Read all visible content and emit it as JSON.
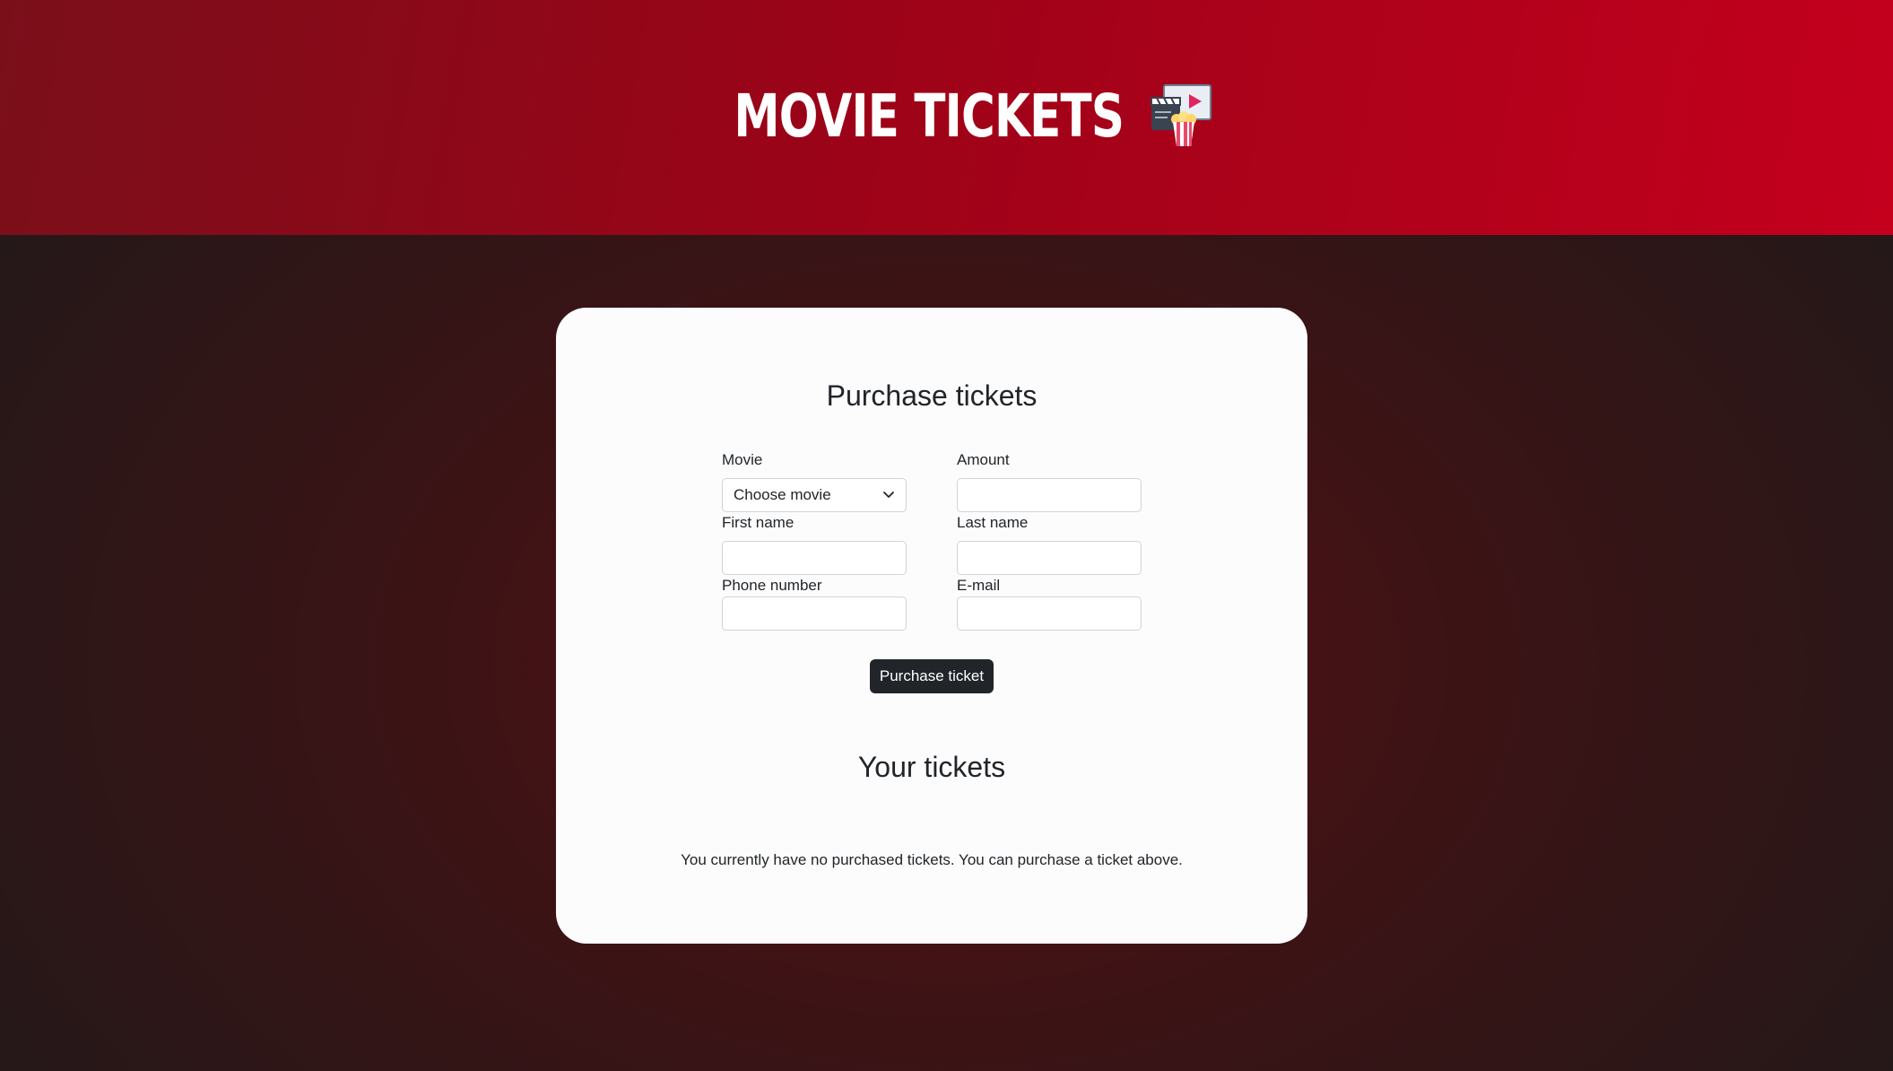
{
  "header": {
    "title": "MOVIE TICKETS",
    "title_icon": "cinema-popcorn-icon",
    "gradient_colors": [
      "#7a0f1a",
      "#9c0318",
      "#c4001d"
    ]
  },
  "purchase_form": {
    "heading": "Purchase tickets",
    "movie": {
      "label": "Movie",
      "selected": "Choose movie"
    },
    "amount": {
      "label": "Amount",
      "value": ""
    },
    "first_name": {
      "label": "First name",
      "value": ""
    },
    "last_name": {
      "label": "Last name",
      "value": ""
    },
    "phone": {
      "label": "Phone number",
      "value": ""
    },
    "email": {
      "label": "E-mail",
      "value": ""
    },
    "submit_label": "Purchase ticket"
  },
  "tickets": {
    "heading": "Your tickets",
    "empty_message": "You currently have no purchased tickets. You can purchase a ticket above."
  },
  "colors": {
    "button": "#212529",
    "card": "#fcfcfc",
    "text": "#212529"
  }
}
